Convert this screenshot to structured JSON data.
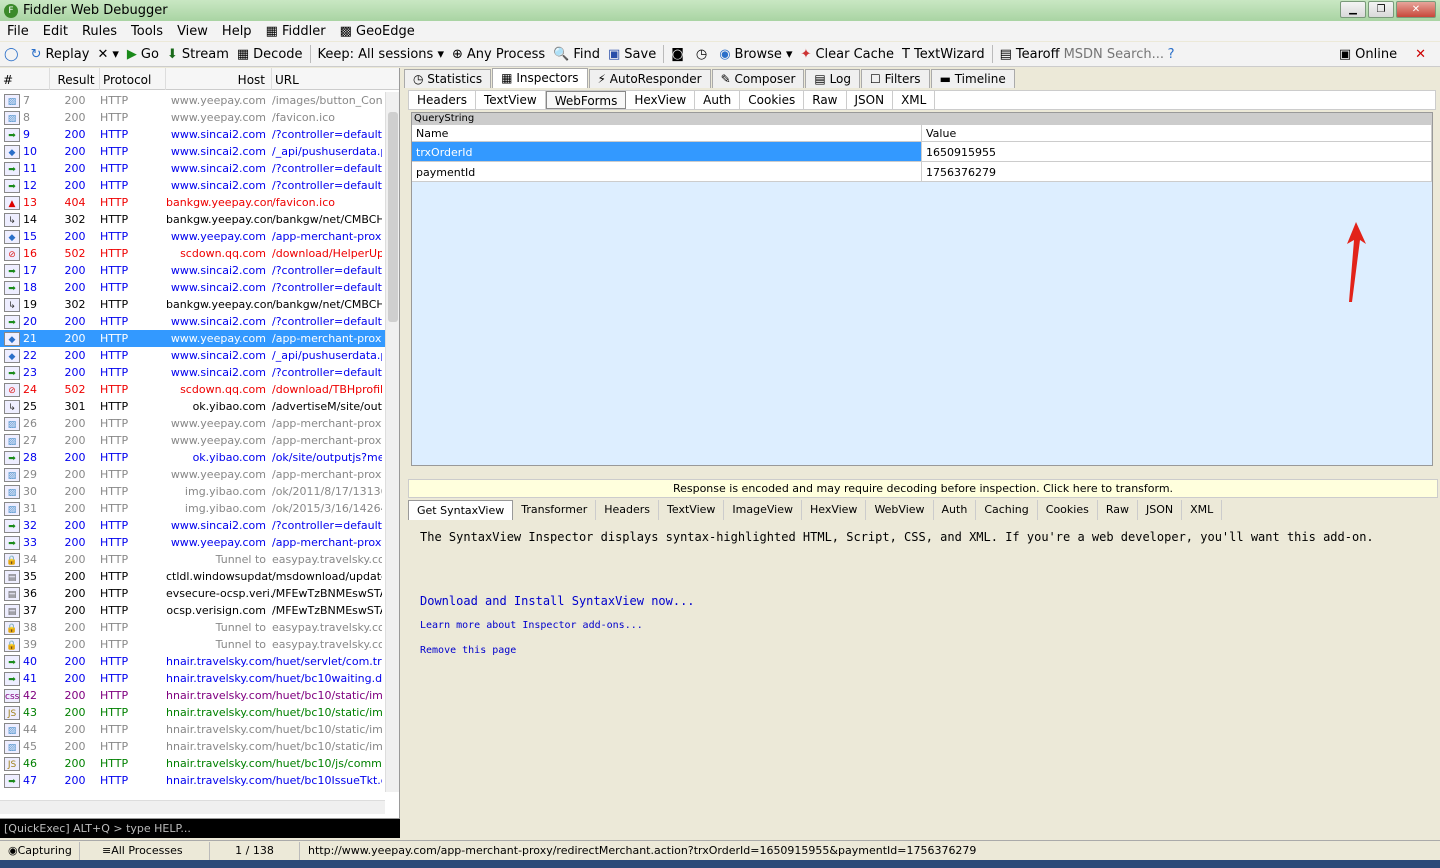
{
  "window": {
    "title": "Fiddler Web Debugger"
  },
  "menu": [
    "File",
    "Edit",
    "Rules",
    "Tools",
    "View",
    "Help",
    "Fiddler",
    "GeoEdge"
  ],
  "toolbar": {
    "replay": "Replay",
    "go": "Go",
    "stream": "Stream",
    "decode": "Decode",
    "keep": "Keep: All sessions",
    "any_process": "Any Process",
    "find": "Find",
    "save": "Save",
    "browse": "Browse",
    "clear_cache": "Clear Cache",
    "textwizard": "TextWizard",
    "tearoff": "Tearoff",
    "msdn_placeholder": "MSDN Search...",
    "online": "Online"
  },
  "sessions": {
    "headers": [
      "#",
      "Result",
      "Protocol",
      "Host",
      "URL"
    ],
    "rows": [
      {
        "id": "7",
        "result": "200",
        "protocol": "HTTP",
        "host": "www.yeepay.com",
        "url": "/images/button_Confi",
        "color": "#888",
        "icon": "img"
      },
      {
        "id": "8",
        "result": "200",
        "protocol": "HTTP",
        "host": "www.yeepay.com",
        "url": "/favicon.ico",
        "color": "#888",
        "icon": "img"
      },
      {
        "id": "9",
        "result": "200",
        "protocol": "HTTP",
        "host": "www.sincai2.com",
        "url": "/?controller=default&",
        "color": "#0000ee",
        "icon": "arrow"
      },
      {
        "id": "10",
        "result": "200",
        "protocol": "HTTP",
        "host": "www.sincai2.com",
        "url": "/_api/pushuserdata.pl",
        "color": "#0000ee",
        "icon": "json"
      },
      {
        "id": "11",
        "result": "200",
        "protocol": "HTTP",
        "host": "www.sincai2.com",
        "url": "/?controller=default&",
        "color": "#0000ee",
        "icon": "arrow"
      },
      {
        "id": "12",
        "result": "200",
        "protocol": "HTTP",
        "host": "www.sincai2.com",
        "url": "/?controller=default&",
        "color": "#0000ee",
        "icon": "arrow"
      },
      {
        "id": "13",
        "result": "404",
        "protocol": "HTTP",
        "host": "bankgw.yeepay.com",
        "url": "/favicon.ico",
        "color": "#ee0000",
        "icon": "warn"
      },
      {
        "id": "14",
        "result": "302",
        "protocol": "HTTP",
        "host": "bankgw.yeepay.com",
        "url": "/bankgw/net/CMBCHI",
        "color": "#000",
        "icon": "redir"
      },
      {
        "id": "15",
        "result": "200",
        "protocol": "HTTP",
        "host": "www.yeepay.com",
        "url": "/app-merchant-proxy/",
        "color": "#0000ee",
        "icon": "json"
      },
      {
        "id": "16",
        "result": "502",
        "protocol": "HTTP",
        "host": "scdown.qq.com",
        "url": "/download/HelperUpd",
        "color": "#ee0000",
        "icon": "block"
      },
      {
        "id": "17",
        "result": "200",
        "protocol": "HTTP",
        "host": "www.sincai2.com",
        "url": "/?controller=default&",
        "color": "#0000ee",
        "icon": "arrow"
      },
      {
        "id": "18",
        "result": "200",
        "protocol": "HTTP",
        "host": "www.sincai2.com",
        "url": "/?controller=default&",
        "color": "#0000ee",
        "icon": "arrow"
      },
      {
        "id": "19",
        "result": "302",
        "protocol": "HTTP",
        "host": "bankgw.yeepay.com",
        "url": "/bankgw/net/CMBCHI",
        "color": "#000",
        "icon": "redir"
      },
      {
        "id": "20",
        "result": "200",
        "protocol": "HTTP",
        "host": "www.sincai2.com",
        "url": "/?controller=default&",
        "color": "#0000ee",
        "icon": "arrow"
      },
      {
        "id": "21",
        "result": "200",
        "protocol": "HTTP",
        "host": "www.yeepay.com",
        "url": "/app-merchant-proxy/",
        "color": "#fff",
        "icon": "json",
        "selected": true
      },
      {
        "id": "22",
        "result": "200",
        "protocol": "HTTP",
        "host": "www.sincai2.com",
        "url": "/_api/pushuserdata.pl",
        "color": "#0000ee",
        "icon": "json"
      },
      {
        "id": "23",
        "result": "200",
        "protocol": "HTTP",
        "host": "www.sincai2.com",
        "url": "/?controller=default&",
        "color": "#0000ee",
        "icon": "arrow"
      },
      {
        "id": "24",
        "result": "502",
        "protocol": "HTTP",
        "host": "scdown.qq.com",
        "url": "/download/TBHprofileF",
        "color": "#ee0000",
        "icon": "block"
      },
      {
        "id": "25",
        "result": "301",
        "protocol": "HTTP",
        "host": "ok.yibao.com",
        "url": "/advertiseM/site/outpu",
        "color": "#000",
        "icon": "redir"
      },
      {
        "id": "26",
        "result": "200",
        "protocol": "HTTP",
        "host": "www.yeepay.com",
        "url": "/app-merchant-proxy/",
        "color": "#888",
        "icon": "img"
      },
      {
        "id": "27",
        "result": "200",
        "protocol": "HTTP",
        "host": "www.yeepay.com",
        "url": "/app-merchant-proxy/",
        "color": "#888",
        "icon": "img"
      },
      {
        "id": "28",
        "result": "200",
        "protocol": "HTTP",
        "host": "ok.yibao.com",
        "url": "/ok/site/outputjs?merc",
        "color": "#0000ee",
        "icon": "arrow"
      },
      {
        "id": "29",
        "result": "200",
        "protocol": "HTTP",
        "host": "www.yeepay.com",
        "url": "/app-merchant-proxy/",
        "color": "#888",
        "icon": "img"
      },
      {
        "id": "30",
        "result": "200",
        "protocol": "HTTP",
        "host": "img.yibao.com",
        "url": "/ok/2011/8/17/13136",
        "color": "#888",
        "icon": "img"
      },
      {
        "id": "31",
        "result": "200",
        "protocol": "HTTP",
        "host": "img.yibao.com",
        "url": "/ok/2015/3/16/14264",
        "color": "#888",
        "icon": "img"
      },
      {
        "id": "32",
        "result": "200",
        "protocol": "HTTP",
        "host": "www.sincai2.com",
        "url": "/?controller=default&",
        "color": "#0000ee",
        "icon": "arrow"
      },
      {
        "id": "33",
        "result": "200",
        "protocol": "HTTP",
        "host": "www.yeepay.com",
        "url": "/app-merchant-proxy/",
        "color": "#0000ee",
        "icon": "arrow"
      },
      {
        "id": "34",
        "result": "200",
        "protocol": "HTTP",
        "host": "Tunnel to",
        "url": "easypay.travelsky.co",
        "color": "#888",
        "icon": "lock"
      },
      {
        "id": "35",
        "result": "200",
        "protocol": "HTTP",
        "host": "ctldl.windowsupdat...",
        "url": "/msdownload/update/",
        "color": "#000",
        "icon": "doc"
      },
      {
        "id": "36",
        "result": "200",
        "protocol": "HTTP",
        "host": "evsecure-ocsp.veri...",
        "url": "/MFEwTzBNMEswSTA",
        "color": "#000",
        "icon": "doc"
      },
      {
        "id": "37",
        "result": "200",
        "protocol": "HTTP",
        "host": "ocsp.verisign.com",
        "url": "/MFEwTzBNMEswSTA",
        "color": "#000",
        "icon": "doc"
      },
      {
        "id": "38",
        "result": "200",
        "protocol": "HTTP",
        "host": "Tunnel to",
        "url": "easypay.travelsky.co",
        "color": "#888",
        "icon": "lock"
      },
      {
        "id": "39",
        "result": "200",
        "protocol": "HTTP",
        "host": "Tunnel to",
        "url": "easypay.travelsky.co",
        "color": "#888",
        "icon": "lock"
      },
      {
        "id": "40",
        "result": "200",
        "protocol": "HTTP",
        "host": "hnair.travelsky.com",
        "url": "/huet/servlet/com.trav",
        "color": "#0000ee",
        "icon": "arrow"
      },
      {
        "id": "41",
        "result": "200",
        "protocol": "HTTP",
        "host": "hnair.travelsky.com",
        "url": "/huet/bc10waiting.do",
        "color": "#0000ee",
        "icon": "arrow"
      },
      {
        "id": "42",
        "result": "200",
        "protocol": "HTTP",
        "host": "hnair.travelsky.com",
        "url": "/huet/bc10/static/imag",
        "color": "#800080",
        "icon": "css"
      },
      {
        "id": "43",
        "result": "200",
        "protocol": "HTTP",
        "host": "hnair.travelsky.com",
        "url": "/huet/bc10/static/imag",
        "color": "#008000",
        "icon": "js"
      },
      {
        "id": "44",
        "result": "200",
        "protocol": "HTTP",
        "host": "hnair.travelsky.com",
        "url": "/huet/bc10/static/imag",
        "color": "#888",
        "icon": "img"
      },
      {
        "id": "45",
        "result": "200",
        "protocol": "HTTP",
        "host": "hnair.travelsky.com",
        "url": "/huet/bc10/static/imag",
        "color": "#888",
        "icon": "img"
      },
      {
        "id": "46",
        "result": "200",
        "protocol": "HTTP",
        "host": "hnair.travelsky.com",
        "url": "/huet/bc10/js/commor",
        "color": "#008000",
        "icon": "js"
      },
      {
        "id": "47",
        "result": "200",
        "protocol": "HTTP",
        "host": "hnair.travelsky.com",
        "url": "/huet/bc10IssueTkt.do",
        "color": "#0000ee",
        "icon": "arrow"
      }
    ]
  },
  "quickexec": "[QuickExec] ALT+Q > type HELP...",
  "status": {
    "capturing": "Capturing",
    "processes": "All Processes",
    "count": "1 / 138",
    "url": "http://www.yeepay.com/app-merchant-proxy/redirectMerchant.action?trxOrderId=1650915955&paymentId=1756376279"
  },
  "tabs": [
    "Statistics",
    "Inspectors",
    "AutoResponder",
    "Composer",
    "Log",
    "Filters",
    "Timeline"
  ],
  "request_tabs": [
    "Headers",
    "TextView",
    "WebForms",
    "HexView",
    "Auth",
    "Cookies",
    "Raw",
    "JSON",
    "XML"
  ],
  "querystring": {
    "title": "QueryString",
    "name_header": "Name",
    "value_header": "Value",
    "rows": [
      {
        "name": "trxOrderId",
        "value": "1650915955"
      },
      {
        "name": "paymentId",
        "value": "1756376279"
      }
    ]
  },
  "notice": "Response is encoded and may require decoding before inspection. Click here to transform.",
  "response_tabs": [
    "Get SyntaxView",
    "Transformer",
    "Headers",
    "TextView",
    "ImageView",
    "HexView",
    "WebView",
    "Auth",
    "Caching",
    "Cookies",
    "Raw",
    "JSON",
    "XML"
  ],
  "syntaxview": {
    "desc": "The SyntaxView Inspector displays syntax-highlighted HTML, Script, CSS, and XML. If you're a web developer, you'll want this add-on.",
    "download": "Download and Install SyntaxView now...",
    "learn": "Learn more about Inspector add-ons...",
    "remove": "Remove this page"
  }
}
